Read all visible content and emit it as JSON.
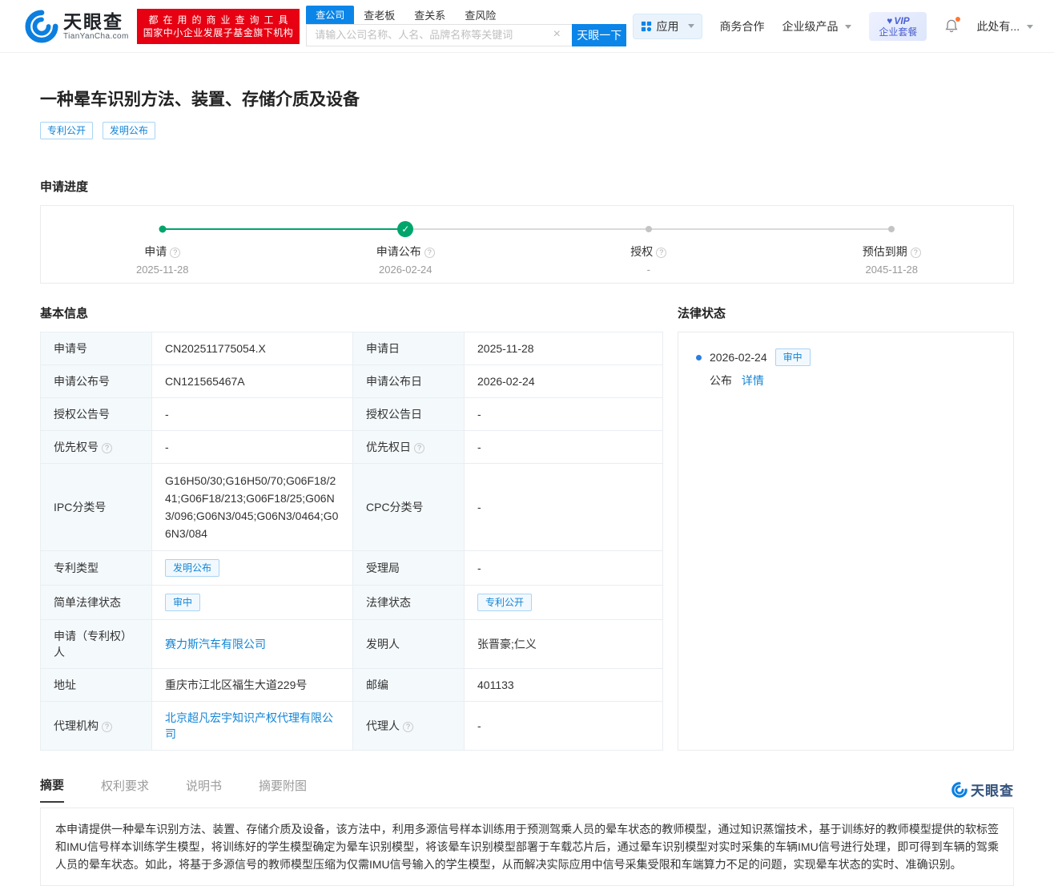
{
  "colors": {
    "brand_blue": "#0b85e8",
    "banner_red": "#e60012",
    "progress_green": "#00a56c",
    "link_blue": "#1285d6",
    "label_cell_bg": "#f4f9fc"
  },
  "header": {
    "logo": {
      "name_cn": "天眼查",
      "name_en": "TianYanCha.com"
    },
    "banner": {
      "line1": "都在用的商业查询工具",
      "line2": "国家中小企业发展子基金旗下机构"
    },
    "search_tabs": [
      {
        "label": "查公司"
      },
      {
        "label": "查老板"
      },
      {
        "label": "查关系"
      },
      {
        "label": "查风险"
      }
    ],
    "search": {
      "placeholder": "请输入公司名称、人名、品牌名称等关键词",
      "button_label": "天眼一下"
    },
    "nav": {
      "apps_label": "应用",
      "cooperation_label": "商务合作",
      "enterprise_label": "企业级产品",
      "vip_line1": "VIP",
      "vip_line2": "企业套餐",
      "user_label": "此处有..."
    }
  },
  "patent": {
    "title": "一种晕车识别方法、装置、存储介质及设备",
    "tag1": "专利公开",
    "tag2": "发明公布"
  },
  "progress": {
    "section_title": "申请进度",
    "steps": [
      {
        "label": "申请",
        "date": "2025-11-28"
      },
      {
        "label": "申请公布",
        "date": "2026-02-24"
      },
      {
        "label": "授权",
        "date": "-"
      },
      {
        "label": "预估到期",
        "date": "2045-11-28"
      }
    ]
  },
  "basic_info": {
    "section_title": "基本信息",
    "rows": [
      {
        "l1": "申请号",
        "v1": "CN202511775054.X",
        "l2": "申请日",
        "v2": "2025-11-28"
      },
      {
        "l1": "申请公布号",
        "v1": "CN121565467A",
        "l2": "申请公布日",
        "v2": "2026-02-24"
      },
      {
        "l1": "授权公告号",
        "v1": "-",
        "l2": "授权公告日",
        "v2": "-"
      },
      {
        "l1": "优先权号",
        "v1": "-",
        "l2": "优先权日",
        "v2": "-"
      },
      {
        "l1": "IPC分类号",
        "v1": "G16H50/30;G16H50/70;G06F18/241;G06F18/213;G06F18/25;G06N3/096;G06N3/045;G06N3/0464;G06N3/084",
        "l2": "CPC分类号",
        "v2": "-"
      },
      {
        "l1": "专利类型",
        "v1": "发明公布",
        "l2": "受理局",
        "v2": "-"
      },
      {
        "l1": "简单法律状态",
        "v1": "审中",
        "l2": "法律状态",
        "v2": "专利公开"
      },
      {
        "l1": "申请（专利权）人",
        "v1": "赛力斯汽车有限公司",
        "l2": "发明人",
        "v2": "张晋豪;仁义"
      },
      {
        "l1": "地址",
        "v1": "重庆市江北区福生大道229号",
        "l2": "邮编",
        "v2": "401133"
      },
      {
        "l1": "代理机构",
        "v1": "北京超凡宏宇知识产权代理有限公司",
        "l2": "代理人",
        "v2": "-"
      }
    ]
  },
  "legal_status": {
    "section_title": "法律状态",
    "item": {
      "date": "2026-02-24",
      "status_tag": "审中",
      "action": "公布",
      "detail_link": "详情"
    }
  },
  "detail_tabs": [
    {
      "label": "摘要"
    },
    {
      "label": "权利要求"
    },
    {
      "label": "说明书"
    },
    {
      "label": "摘要附图"
    }
  ],
  "watermark": {
    "brand": "天眼查"
  },
  "abstract": {
    "text": "本申请提供一种晕车识别方法、装置、存储介质及设备，该方法中，利用多源信号样本训练用于预测驾乘人员的晕车状态的教师模型，通过知识蒸馏技术，基于训练好的教师模型提供的软标签和IMU信号样本训练学生模型，将训练好的学生模型确定为晕车识别模型，将该晕车识别模型部署于车载芯片后，通过晕车识别模型对实时采集的车辆IMU信号进行处理，即可得到车辆的驾乘人员的晕车状态。如此，将基于多源信号的教师模型压缩为仅需IMU信号输入的学生模型，从而解决实际应用中信号采集受限和车端算力不足的问题，实现晕车状态的实时、准确识别。"
  }
}
